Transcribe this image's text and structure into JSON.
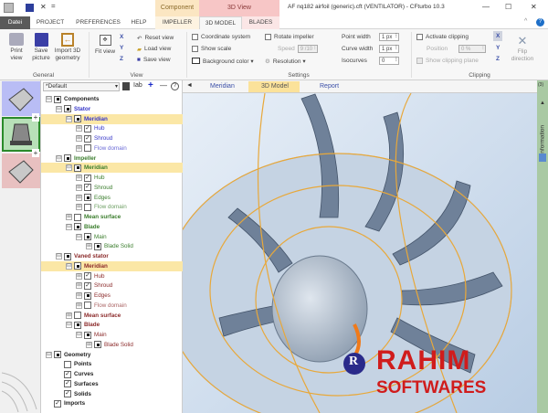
{
  "window": {
    "title": "AF nq182 airfoil (generic).cft (VENTILATOR) - CFturbo 10.3",
    "minimize": "—",
    "maximize": "☐",
    "close": "✕",
    "help": "?",
    "collapse": "^"
  },
  "quick_access": {
    "save": "save-icon",
    "undo": "✕",
    "customize": "="
  },
  "context_groups": {
    "component": "Component",
    "view3d": "3D View"
  },
  "tabs": [
    "Datei",
    "PROJECT",
    "PREFERENCES",
    "HELP",
    "IMPELLER",
    "3D MODEL",
    "BLADES"
  ],
  "active_tab": "3D MODEL",
  "ribbon": {
    "general": {
      "label": "General",
      "print": "Print view",
      "save": "Save picture",
      "import": "Import 3D geometry"
    },
    "view": {
      "label": "View",
      "fit": "Fit view",
      "axes": [
        "X",
        "Y",
        "Z"
      ],
      "reset": "Reset view",
      "load": "Load view",
      "save": "Save view"
    },
    "settings": {
      "label": "Settings",
      "coordinate_system": "Coordinate system",
      "show_scale": "Show scale",
      "background_color": "Background color ▾",
      "rotate_impeller": "Rotate impeller",
      "speed_label": "Speed",
      "speed_value": "9 /10",
      "resolution": "Resolution ▾",
      "point_width_label": "Point width",
      "point_width": "1 px",
      "curve_width_label": "Curve width",
      "curve_width": "1 px",
      "isocurves_label": "Isocurves",
      "isocurves": "0"
    },
    "clipping": {
      "label": "Clipping",
      "activate": "Activate clipping",
      "position_label": "Position",
      "position_value": "0 %",
      "show_plane": "Show clipping plane",
      "axes": [
        "X",
        "Y",
        "Z"
      ],
      "flip": "Flip direction"
    }
  },
  "tree_toolbar": {
    "preset": "*Default",
    "dropdown": "▾",
    "add": "+",
    "remove": "—",
    "help": "?"
  },
  "tree": [
    {
      "label": "Components",
      "level": 0,
      "check": "full",
      "exp": "⊟",
      "cls": "bold",
      "color": "#222"
    },
    {
      "label": "Stator",
      "level": 1,
      "check": "full",
      "exp": "⊟",
      "cls": "bold",
      "color": "#3535c8"
    },
    {
      "label": "Meridian",
      "level": 2,
      "check": "full",
      "exp": "⊟",
      "cls": "bold",
      "color": "#3535c8",
      "hl": true
    },
    {
      "label": "Hub",
      "level": 3,
      "check": "tick",
      "exp": "⊞",
      "color": "#3535c8"
    },
    {
      "label": "Shroud",
      "level": 3,
      "check": "tick",
      "exp": "⊞",
      "color": "#3535c8"
    },
    {
      "label": "Flow domain",
      "level": 3,
      "check": "none",
      "exp": "⊞",
      "color": "#3535c8"
    },
    {
      "label": "Impeller",
      "level": 1,
      "check": "full",
      "exp": "⊟",
      "cls": "bold",
      "color": "#3a7d2c"
    },
    {
      "label": "Meridian",
      "level": 2,
      "check": "full",
      "exp": "⊟",
      "cls": "bold",
      "color": "#3a7d2c",
      "hl": true
    },
    {
      "label": "Hub",
      "level": 3,
      "check": "tick",
      "exp": "⊞",
      "color": "#3a7d2c"
    },
    {
      "label": "Shroud",
      "level": 3,
      "check": "tick",
      "exp": "⊞",
      "color": "#3a7d2c"
    },
    {
      "label": "Edges",
      "level": 3,
      "check": "full",
      "exp": "⊞",
      "color": "#3a7d2c"
    },
    {
      "label": "Flow domain",
      "level": 3,
      "check": "none",
      "exp": "⊞",
      "color": "#3a7d2c"
    },
    {
      "label": "Mean surface",
      "level": 2,
      "check": "none",
      "exp": "⊞",
      "cls": "bold",
      "color": "#3a7d2c"
    },
    {
      "label": "Blade",
      "level": 2,
      "check": "full",
      "exp": "⊟",
      "cls": "bold",
      "color": "#3a7d2c"
    },
    {
      "label": "Main",
      "level": 3,
      "check": "full",
      "exp": "⊟",
      "color": "#3a7d2c"
    },
    {
      "label": "Blade Solid",
      "level": 4,
      "check": "full",
      "exp": "⊞",
      "color": "#3a7d2c"
    },
    {
      "label": "Vaned stator",
      "level": 1,
      "check": "full",
      "exp": "⊟",
      "cls": "bold",
      "color": "#8b2a2a"
    },
    {
      "label": "Meridian",
      "level": 2,
      "check": "full",
      "exp": "⊟",
      "cls": "bold",
      "color": "#8b2a2a",
      "hl": true
    },
    {
      "label": "Hub",
      "level": 3,
      "check": "tick",
      "exp": "⊞",
      "color": "#8b2a2a"
    },
    {
      "label": "Shroud",
      "level": 3,
      "check": "tick",
      "exp": "⊞",
      "color": "#8b2a2a"
    },
    {
      "label": "Edges",
      "level": 3,
      "check": "full",
      "exp": "⊞",
      "color": "#8b2a2a"
    },
    {
      "label": "Flow domain",
      "level": 3,
      "check": "none",
      "exp": "⊞",
      "color": "#8b2a2a"
    },
    {
      "label": "Mean surface",
      "level": 2,
      "check": "none",
      "exp": "⊞",
      "cls": "bold",
      "color": "#8b2a2a"
    },
    {
      "label": "Blade",
      "level": 2,
      "check": "full",
      "exp": "⊟",
      "cls": "bold",
      "color": "#8b2a2a"
    },
    {
      "label": "Main",
      "level": 3,
      "check": "full",
      "exp": "⊟",
      "color": "#8b2a2a"
    },
    {
      "label": "Blade Solid",
      "level": 4,
      "check": "full",
      "exp": "⊞",
      "color": "#8b2a2a"
    },
    {
      "label": "Geometry",
      "level": 0,
      "check": "full",
      "exp": "⊟",
      "cls": "bold",
      "color": "#222"
    },
    {
      "label": "Points",
      "level": 1,
      "check": "none",
      "exp": "",
      "cls": "bold",
      "color": "#222"
    },
    {
      "label": "Curves",
      "level": 1,
      "check": "tick",
      "exp": "",
      "cls": "bold",
      "color": "#222"
    },
    {
      "label": "Surfaces",
      "level": 1,
      "check": "tick",
      "exp": "",
      "cls": "bold",
      "color": "#222"
    },
    {
      "label": "Solids",
      "level": 1,
      "check": "tick",
      "exp": "",
      "cls": "bold",
      "color": "#222"
    },
    {
      "label": "Imports",
      "level": 0,
      "check": "tick",
      "exp": "",
      "cls": "bold",
      "color": "#222"
    }
  ],
  "view_tabs": {
    "nav": "◄",
    "meridian": "Meridian",
    "model3d": "3D Model",
    "report": "Report"
  },
  "info_panel": {
    "label": "Information",
    "count": "(3)",
    "arrow": "▲"
  },
  "watermark": {
    "line1": "RAHIM",
    "line2": "SOFTWARES",
    "letter": "R"
  },
  "colors": {
    "accent_component": "#fbe6c2",
    "accent_3dview": "#f7c6c6",
    "stator": "#3535c8",
    "impeller": "#3a7d2c",
    "vaned": "#8b2a2a"
  }
}
